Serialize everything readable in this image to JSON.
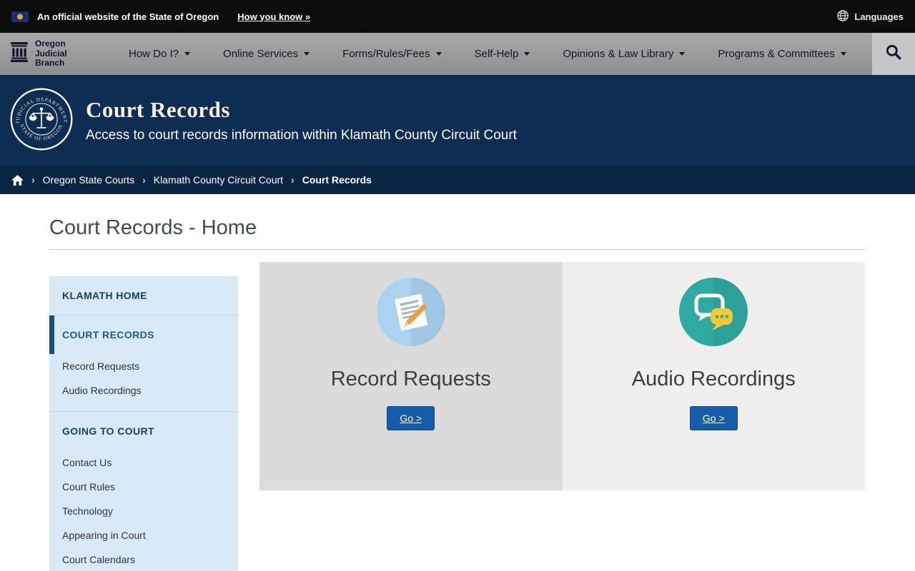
{
  "topbar": {
    "official": "An official website of the State of Oregon",
    "how_you_know": "How you know »",
    "languages": "Languages"
  },
  "nav": {
    "brand_lines": [
      "Oregon",
      "Judicial",
      "Branch"
    ],
    "items": [
      {
        "label": "How Do I?"
      },
      {
        "label": "Online Services"
      },
      {
        "label": "Forms/Rules/Fees"
      },
      {
        "label": "Self-Help"
      },
      {
        "label": "Opinions & Law Library"
      },
      {
        "label": "Programs & Committees"
      }
    ]
  },
  "hero": {
    "title": "Court Records",
    "subtitle": "Access to court records information within Klamath County Circuit Court"
  },
  "seal": {
    "top_text": "JUDICIAL DEPARTMENT",
    "bottom_text": "STATE OF OREGON"
  },
  "breadcrumb": {
    "items": [
      {
        "label": "Oregon State Courts"
      },
      {
        "label": "Klamath County Circuit Court"
      },
      {
        "label": "Court Records"
      }
    ]
  },
  "main": {
    "heading": "Court Records - Home",
    "cards": [
      {
        "title": "Record Requests",
        "button_label": "Go >"
      },
      {
        "title": "Audio Recordings",
        "button_label": "Go >"
      }
    ]
  },
  "sidebar": {
    "sections": [
      {
        "header": "KLAMATH HOME",
        "items": []
      },
      {
        "header": "COURT RECORDS",
        "items": [
          "Record Requests",
          "Audio Recordings"
        ]
      },
      {
        "header": "GOING TO COURT",
        "items": [
          "Contact Us",
          "Court Rules",
          "Technology",
          "Appearing in Court",
          "Court Calendars"
        ]
      }
    ]
  },
  "colors": {
    "hero_navy": "#0e2d52",
    "breadcrumb_navy": "#0a2443",
    "button_blue": "#155cab",
    "sidebar_blue": "#d8e9f8",
    "record_icon_blue": "#a9d3ef",
    "audio_icon_teal": "#2faaa3"
  }
}
